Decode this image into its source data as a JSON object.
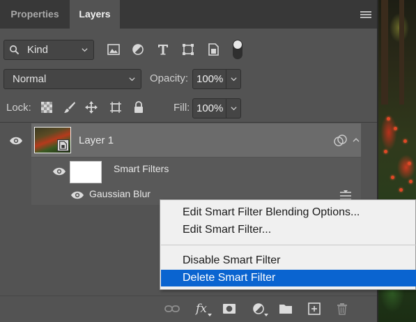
{
  "tabs": [
    {
      "label": "Properties",
      "active": false
    },
    {
      "label": "Layers",
      "active": true
    }
  ],
  "filter": {
    "kind_label": "Kind",
    "icons": [
      "image-filter-icon",
      "adjustment-filter-icon",
      "type-filter-icon",
      "shape-filter-icon",
      "smart-object-filter-icon"
    ]
  },
  "blend": {
    "mode": "Normal",
    "opacity_label": "Opacity:",
    "opacity_value": "100%"
  },
  "lock": {
    "label": "Lock:",
    "icons": [
      "lock-transparent-pixels-icon",
      "lock-image-pixels-icon",
      "lock-position-icon",
      "lock-artboard-icon",
      "lock-all-icon"
    ],
    "fill_label": "Fill:",
    "fill_value": "100%"
  },
  "layers": [
    {
      "name": "Layer 1",
      "visible": true,
      "selected": true,
      "smart_filters_label": "Smart Filters",
      "filters": [
        {
          "name": "Gaussian Blur",
          "visible": true
        }
      ]
    }
  ],
  "context_menu": {
    "items": [
      {
        "label": "Edit Smart Filter Blending Options...",
        "highlighted": false
      },
      {
        "label": "Edit Smart Filter...",
        "highlighted": false
      },
      {
        "label": "Disable Smart Filter",
        "highlighted": false
      },
      {
        "label": "Delete Smart Filter",
        "highlighted": true
      }
    ]
  },
  "bottom_toolbar": {
    "icons": [
      "link-layers-icon",
      "fx-icon",
      "layer-mask-icon",
      "adjustment-layer-icon",
      "new-group-icon",
      "new-layer-icon",
      "delete-layer-icon"
    ],
    "fx_label": "fx"
  },
  "colors": {
    "panel_bg": "#535353",
    "tab_strip": "#383838",
    "selected_row": "#6b6b6b",
    "menu_bg": "#f0f0f0",
    "menu_highlight": "#0a64d0"
  }
}
